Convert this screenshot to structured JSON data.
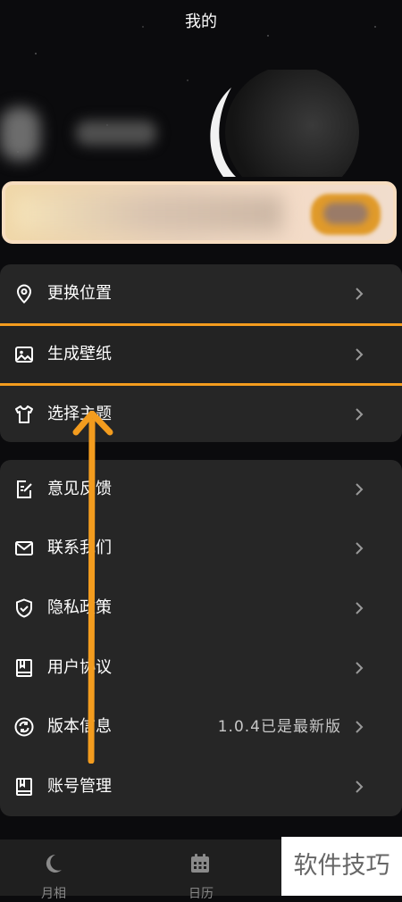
{
  "header": {
    "title": "我的"
  },
  "menu_group_1": [
    {
      "label": "更换位置",
      "icon": "location-pin-icon"
    },
    {
      "label": "生成壁纸",
      "icon": "image-icon",
      "highlighted": true
    },
    {
      "label": "选择主题",
      "icon": "tshirt-icon"
    }
  ],
  "menu_group_2": [
    {
      "label": "意见反馈",
      "icon": "edit-note-icon"
    },
    {
      "label": "联系我们",
      "icon": "mail-icon"
    },
    {
      "label": "隐私政策",
      "icon": "shield-check-icon"
    },
    {
      "label": "用户协议",
      "icon": "book-icon"
    },
    {
      "label": "版本信息",
      "icon": "refresh-icon",
      "value": "1.0.4已是最新版"
    },
    {
      "label": "账号管理",
      "icon": "account-book-icon"
    }
  ],
  "tabbar": [
    {
      "label": "月相",
      "icon": "moon-icon"
    },
    {
      "label": "日历",
      "icon": "calendar-icon"
    }
  ],
  "watermark": "软件技巧",
  "colors": {
    "accent": "#f39c1e",
    "card": "#262626",
    "background": "#0b0b0d"
  }
}
